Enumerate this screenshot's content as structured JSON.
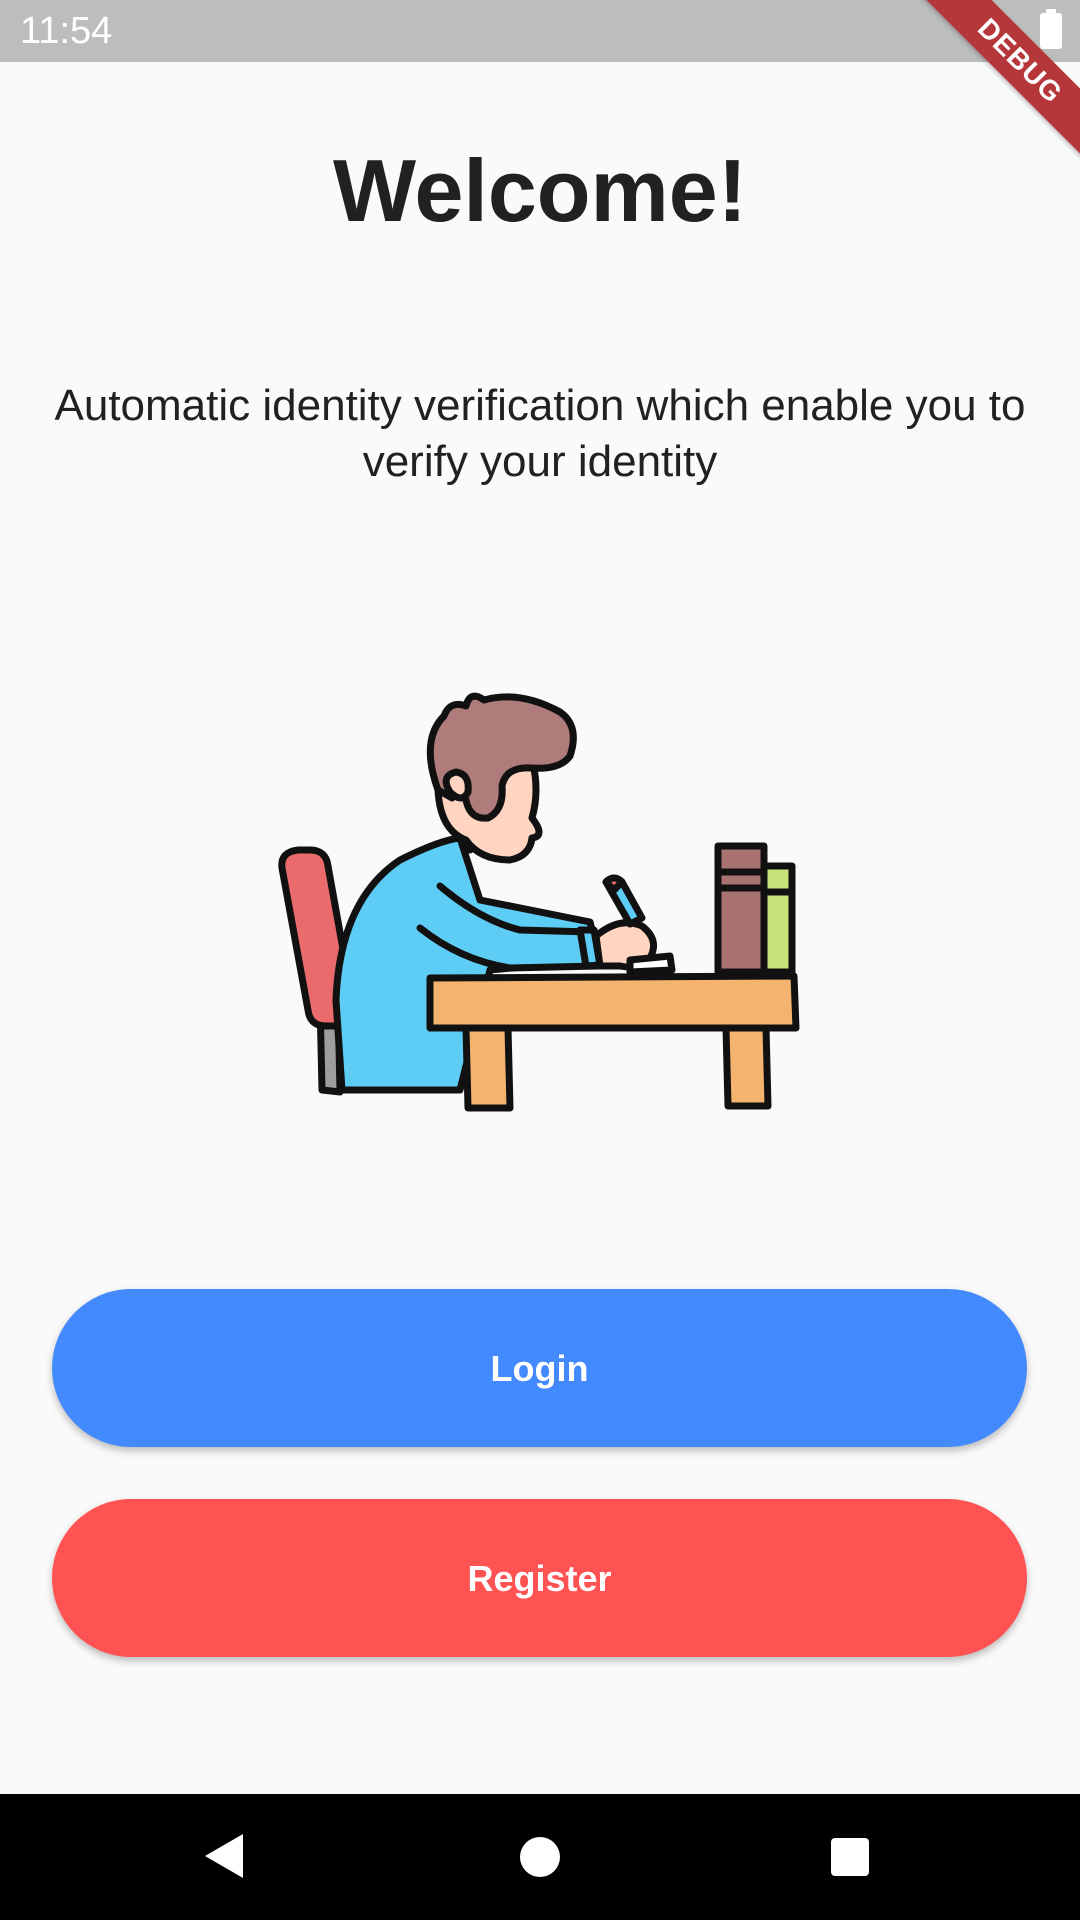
{
  "status_bar": {
    "time": "11:54"
  },
  "debug_banner": {
    "label": "DEBUG"
  },
  "welcome": {
    "title": "Welcome!",
    "subtitle": "Automatic identity verification which enable you to verify your identity"
  },
  "illustration": {
    "icon": "person-writing-at-desk-illustration"
  },
  "buttons": {
    "login_label": "Login",
    "register_label": "Register"
  },
  "colors": {
    "login": "#448aff",
    "register": "#ff5252",
    "status_bar": "#bdbdbd",
    "debug_banner": "#b5373a"
  },
  "nav_bar": {
    "icons": [
      "back-icon",
      "home-icon",
      "recents-icon"
    ]
  }
}
